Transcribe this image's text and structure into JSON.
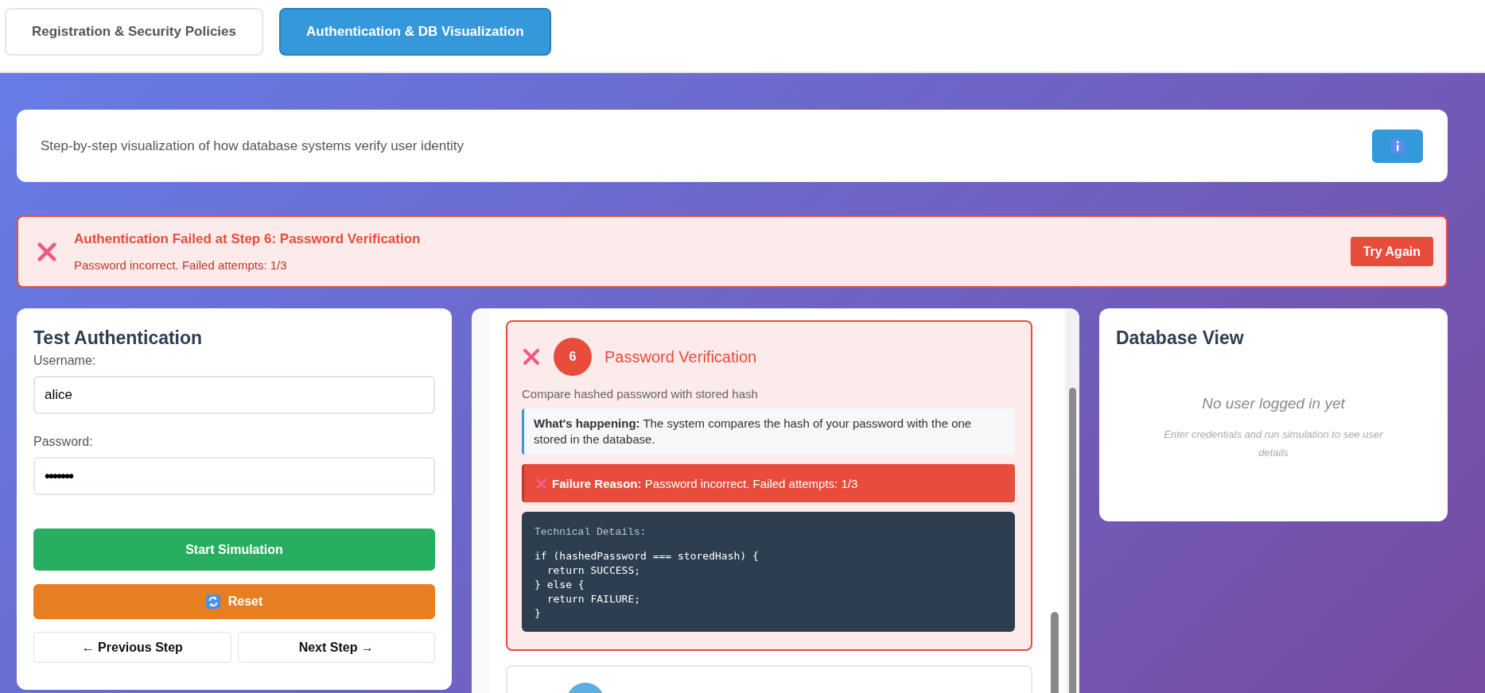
{
  "tabs": [
    {
      "label": "Registration & Security Policies",
      "selected": false
    },
    {
      "label": "Authentication & DB Visualization",
      "selected": true
    }
  ],
  "intro": {
    "text": "Step-by-step visualization of how database systems verify user identity"
  },
  "alert": {
    "title": "Authentication Failed at Step 6: Password Verification",
    "message": "Password incorrect. Failed attempts: 1/3",
    "button": "Try Again"
  },
  "auth_form": {
    "title": "Test Authentication",
    "fields": [
      {
        "label": "Username:",
        "value": "alice",
        "kind": "text"
      },
      {
        "label": "Password:",
        "value": "•••••••",
        "kind": "password"
      }
    ],
    "buttons": [
      {
        "label": "Start Simulation",
        "kind": "primary"
      },
      {
        "label": "Reset",
        "kind": "reset"
      }
    ],
    "nav": [
      {
        "label": "← Previous Step"
      },
      {
        "label": "Next Step →"
      }
    ]
  },
  "steps": [
    {
      "failed": true,
      "number": "6",
      "title": "Password Verification",
      "description": "Compare hashed password with stored hash",
      "explanation": "**What's happening:** The system compares the hash of your password with the one stored in the database.",
      "failure": "**Failure Reason:** Password incorrect. Failed attempts: 1/3",
      "technical_title": "Technical Details:",
      "code": "if (hashedPassword === storedHash) {\n  return SUCCESS;\n} else {\n  return FAILURE;\n}"
    },
    {
      "failed": false
    }
  ],
  "database": {
    "title": "Database View",
    "empty_title": "No user logged in yet",
    "empty_hint": "Enter credentials and run simulation to see user details"
  }
}
